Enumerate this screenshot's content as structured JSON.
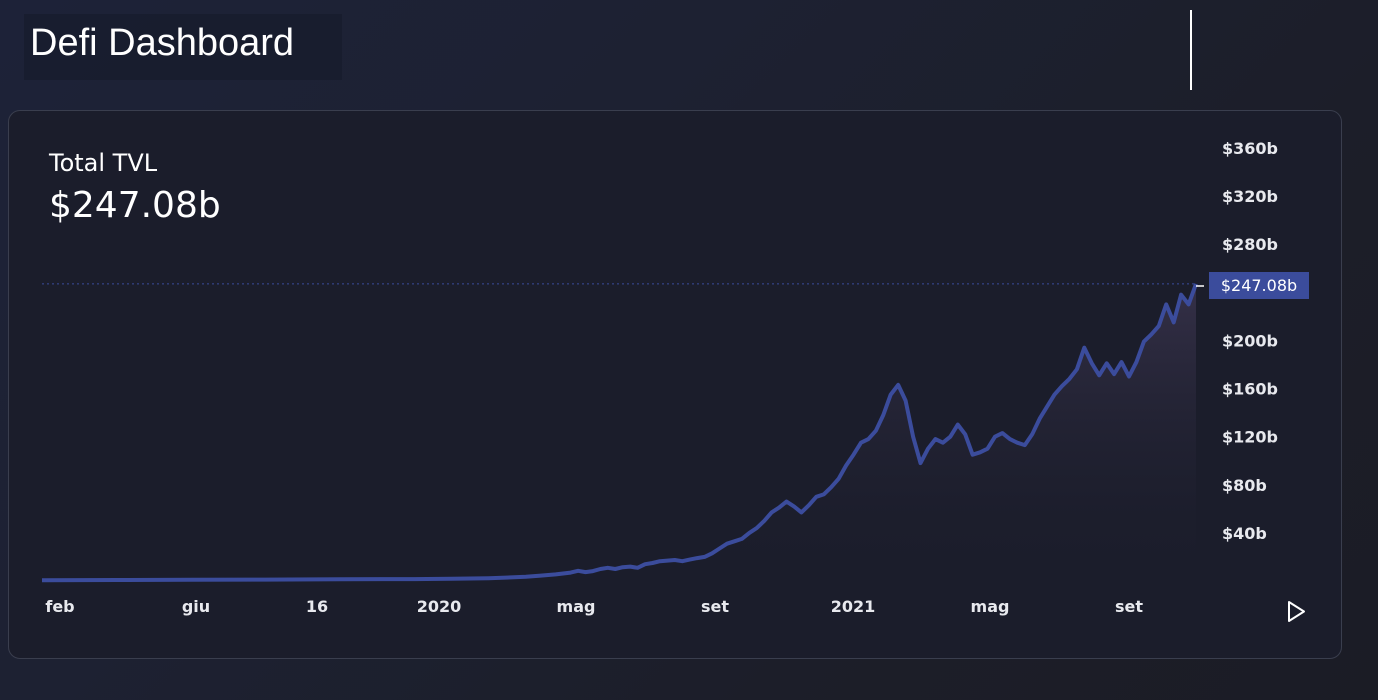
{
  "header": {
    "title": "Defi Dashboard"
  },
  "card": {
    "label": "Total TVL",
    "value": "$247.08b"
  },
  "colors": {
    "line": "#3b4c9c",
    "price_tag": "#3b4c9c",
    "area_top": "#4a4060",
    "background": "#1b1d2b"
  },
  "chart_data": {
    "type": "area",
    "x_labels": [
      "feb",
      "giu",
      "16",
      "2020",
      "mag",
      "set",
      "2021",
      "mag",
      "set"
    ],
    "y_tick_labels": [
      "$40b",
      "$80b",
      "$120b",
      "$160b",
      "$200b",
      "$280b",
      "$320b",
      "$360b"
    ],
    "y_tick_values": [
      40,
      80,
      120,
      160,
      200,
      280,
      320,
      360
    ],
    "ylim": [
      0,
      360
    ],
    "current_value": 247.08,
    "current_label": "$247.08b",
    "grid": false,
    "series": [
      {
        "values": [
          [
            0,
            0.6
          ],
          [
            10,
            0.8
          ],
          [
            20,
            1.0
          ],
          [
            30,
            1.2
          ],
          [
            40,
            1.5
          ],
          [
            50,
            1.6
          ],
          [
            55,
            1.8
          ],
          [
            60,
            2.3
          ],
          [
            63,
            3.0
          ],
          [
            65,
            3.6
          ],
          [
            67,
            4.5
          ],
          [
            69,
            5.5
          ],
          [
            71,
            7.0
          ],
          [
            72,
            8.5
          ],
          [
            73,
            7.4
          ],
          [
            74,
            8.2
          ],
          [
            75,
            10.0
          ],
          [
            76,
            11.0
          ],
          [
            77,
            10.0
          ],
          [
            78,
            11.5
          ],
          [
            79,
            12.0
          ],
          [
            80,
            11.0
          ],
          [
            81,
            14.0
          ],
          [
            82,
            15.0
          ],
          [
            83,
            16.5
          ],
          [
            84,
            17.0
          ],
          [
            85,
            17.5
          ],
          [
            86,
            16.5
          ],
          [
            87,
            17.8
          ],
          [
            88,
            19.0
          ],
          [
            89,
            20.0
          ],
          [
            90,
            23.0
          ],
          [
            91,
            27.0
          ],
          [
            92,
            31.0
          ],
          [
            93,
            33.0
          ],
          [
            94,
            35.0
          ],
          [
            95,
            40.0
          ],
          [
            96,
            44.0
          ],
          [
            97,
            50.0
          ],
          [
            98,
            57.0
          ],
          [
            99,
            61.0
          ],
          [
            100,
            66.0
          ],
          [
            101,
            62.0
          ],
          [
            102,
            57.0
          ],
          [
            103,
            63.0
          ],
          [
            104,
            70.0
          ],
          [
            105,
            72.0
          ],
          [
            106,
            78.0
          ],
          [
            107,
            85.0
          ],
          [
            108,
            96.0
          ],
          [
            109,
            105.0
          ],
          [
            110,
            115.0
          ],
          [
            111,
            118.0
          ],
          [
            112,
            125.0
          ],
          [
            113,
            138.0
          ],
          [
            114,
            155.0
          ],
          [
            115,
            163.0
          ],
          [
            116,
            150.0
          ],
          [
            117,
            120.0
          ],
          [
            118,
            98.0
          ],
          [
            119,
            110.0
          ],
          [
            120,
            118.0
          ],
          [
            121,
            115.0
          ],
          [
            122,
            120.0
          ],
          [
            123,
            130.0
          ],
          [
            124,
            122.0
          ],
          [
            125,
            105.0
          ],
          [
            126,
            107.0
          ],
          [
            127,
            110.0
          ],
          [
            128,
            120.0
          ],
          [
            129,
            123.0
          ],
          [
            130,
            118.0
          ],
          [
            131,
            115.0
          ],
          [
            132,
            113.0
          ],
          [
            133,
            122.0
          ],
          [
            134,
            135.0
          ],
          [
            135,
            145.0
          ],
          [
            136,
            155.0
          ],
          [
            137,
            162.0
          ],
          [
            138,
            168.0
          ],
          [
            139,
            176.0
          ],
          [
            140,
            194.0
          ],
          [
            141,
            181.0
          ],
          [
            142,
            171.0
          ],
          [
            143,
            181.0
          ],
          [
            144,
            172.0
          ],
          [
            145,
            182.0
          ],
          [
            146,
            170.0
          ],
          [
            147,
            182.0
          ],
          [
            148,
            199.0
          ],
          [
            149,
            205.0
          ],
          [
            150,
            212.0
          ],
          [
            151,
            230.0
          ],
          [
            152,
            215.0
          ],
          [
            153,
            238.0
          ],
          [
            154,
            230.0
          ],
          [
            155,
            247.0
          ]
        ]
      }
    ]
  }
}
